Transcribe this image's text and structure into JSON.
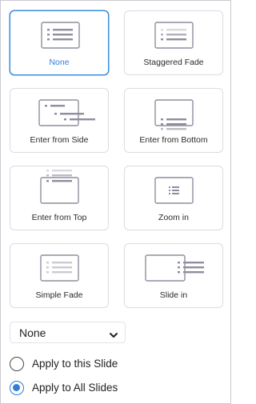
{
  "animations": [
    {
      "label": "None",
      "selected": true,
      "icon": "none-icon"
    },
    {
      "label": "Staggered Fade",
      "selected": false,
      "icon": "staggered-fade-icon"
    },
    {
      "label": "Enter from Side",
      "selected": false,
      "icon": "enter-from-side-icon"
    },
    {
      "label": "Enter from Bottom",
      "selected": false,
      "icon": "enter-from-bottom-icon"
    },
    {
      "label": "Enter from Top",
      "selected": false,
      "icon": "enter-from-top-icon"
    },
    {
      "label": "Zoom in",
      "selected": false,
      "icon": "zoom-in-icon"
    },
    {
      "label": "Simple Fade",
      "selected": false,
      "icon": "simple-fade-icon"
    },
    {
      "label": "Slide in",
      "selected": false,
      "icon": "slide-in-icon"
    }
  ],
  "dropdown": {
    "value": "None",
    "icon": "chevron-down-icon"
  },
  "apply": {
    "options": [
      {
        "label": "Apply to this Slide",
        "checked": false
      },
      {
        "label": "Apply to All Slides",
        "checked": true
      }
    ]
  },
  "colors": {
    "accent": "#2f7fd8",
    "icon_gray": "#8e8e9e"
  }
}
